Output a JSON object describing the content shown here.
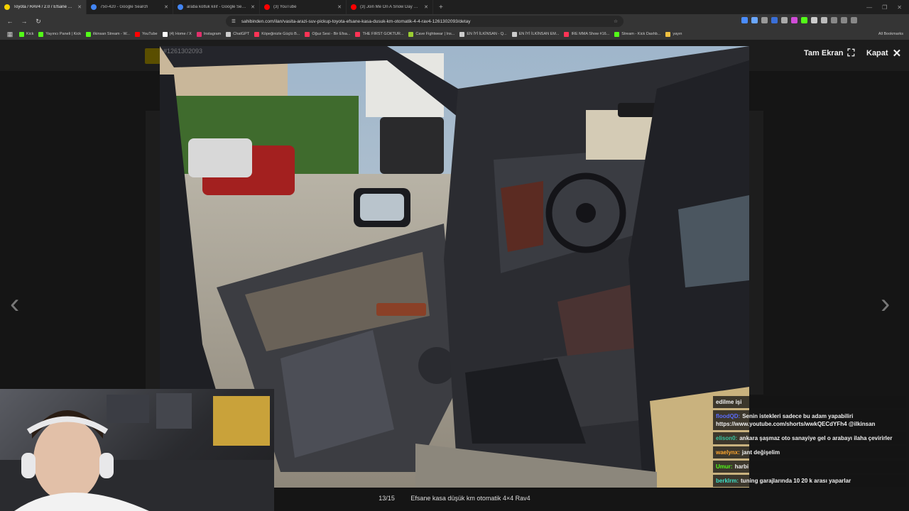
{
  "tabs": [
    {
      "title": "Toyota / RAV4 / 2.0 / Efsane kasa",
      "active": true,
      "color": "#f4d200"
    },
    {
      "title": "750-420 - Google Search",
      "active": false,
      "color": "#4285f4"
    },
    {
      "title": "araba koltuk kılıf - Google Search",
      "active": false,
      "color": "#4285f4"
    },
    {
      "title": "(3) YouTube",
      "active": false,
      "color": "#ff0000"
    },
    {
      "title": "(3) Join Me On A Snow Day Drive In",
      "active": false,
      "color": "#ff0000"
    }
  ],
  "address": "sahibinden.com/ilan/vasita-arazi-suv-pickup-toyota-efsane-kasa-dusuk-km-otomatik-4-4-rav4-1261302093/detay",
  "bookmarks": [
    {
      "label": "Kick",
      "color": "#53fc18"
    },
    {
      "label": "Yayıncı Paneli | Kick",
      "color": "#53fc18"
    },
    {
      "label": "ilkinsan Stream - W...",
      "color": "#53fc18"
    },
    {
      "label": "YouTube",
      "color": "#ff0000"
    },
    {
      "label": "(4) Home / X",
      "color": "#ffffff"
    },
    {
      "label": "Instagram",
      "color": "#e1306c"
    },
    {
      "label": "ChatGPT",
      "color": "#cccccc"
    },
    {
      "label": "Köpeğinizle Güçlü B...",
      "color": "#ff3355"
    },
    {
      "label": "Oğuz Sesi - Bir Efsa...",
      "color": "#ff3355"
    },
    {
      "label": "THE FIRST GOKTUR...",
      "color": "#ff3355"
    },
    {
      "label": "Cave Fightwear | Ins...",
      "color": "#9acd32"
    },
    {
      "label": "EN İYİ İLKİNSAN - Q...",
      "color": "#cccccc"
    },
    {
      "label": "EN İYİ İLKİNSAN EM...",
      "color": "#cccccc"
    },
    {
      "label": "IRE MMA Show #16...",
      "color": "#ff3355"
    },
    {
      "label": "Stream - Kick Dashb...",
      "color": "#53fc18"
    },
    {
      "label": "yayın",
      "color": "#f0c040"
    }
  ],
  "bookmarks_all": "All Bookmarks",
  "viewer": {
    "fullscreen_label": "Tam Ekran",
    "close_label": "Kapat",
    "counter": "13/15",
    "caption": "Efsane kasa düşük km otomatik 4×4 Rav4",
    "listing_no": "#1261302093"
  },
  "chat": [
    {
      "user": "",
      "text": "edilme işi",
      "color": "#ffffff"
    },
    {
      "user": "floodQD:",
      "text": "Senin istekleri sadece bu adam yapabiliri https://www.youtube.com/shorts/wwkQECdYFh4 @ilkinsan",
      "color": "#5b6cff"
    },
    {
      "user": "elison0:",
      "text": "ankara şaşmaz oto sanayiye gel o arabayı ilaha çevirirler",
      "color": "#37c4a0"
    },
    {
      "user": "waelynx:",
      "text": "jant değişelim",
      "color": "#ffa62e"
    },
    {
      "user": "Umur:",
      "text": "harbi",
      "color": "#53fc18"
    },
    {
      "user": "berklrm:",
      "text": "tuning garajlarında 10 20 k arası yaparlar",
      "color": "#3ee0c8"
    }
  ]
}
